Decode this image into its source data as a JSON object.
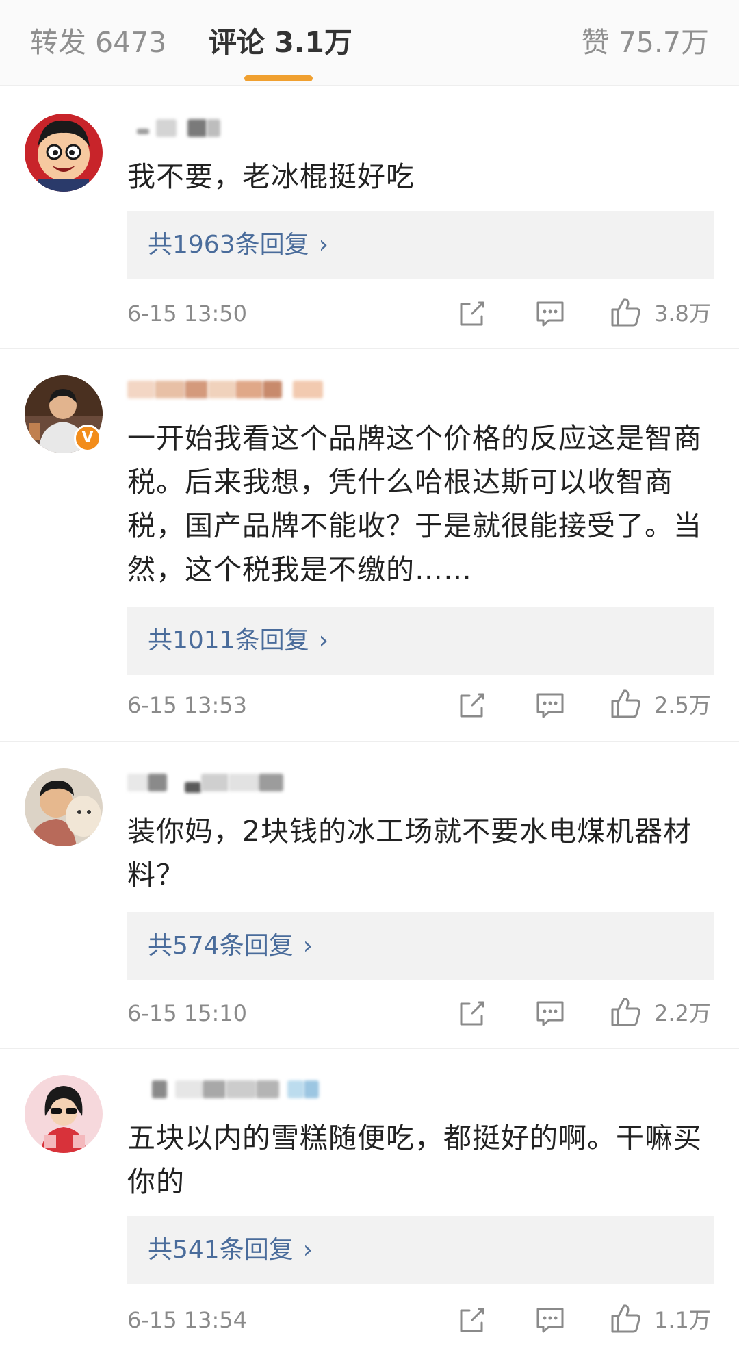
{
  "tabs": {
    "repost_label": "转发 6473",
    "comments_label": "评论 3.1万",
    "likes_label": "赞 75.7万"
  },
  "colors": {
    "accent": "#f0a030",
    "link": "#4a6c9b",
    "meta": "#8a8a8a",
    "reply_bg": "#f2f2f2",
    "verified_badge": "#f28c1a"
  },
  "comments": [
    {
      "content": "我不要，老冰棍挺好吃",
      "replies_label": "共1963条回复",
      "time": "6-15 13:50",
      "likes": "3.8万",
      "verified": false
    },
    {
      "content": "一开始我看这个品牌这个价格的反应这是智商税。后来我想，凭什么哈根达斯可以收智商税，国产品牌不能收？于是就很能接受了。当然，这个税我是不缴的……",
      "replies_label": "共1011条回复",
      "time": "6-15 13:53",
      "likes": "2.5万",
      "verified": true,
      "badge": "V"
    },
    {
      "content": "装你妈，2块钱的冰工场就不要水电煤机器材料？",
      "replies_label": "共574条回复",
      "time": "6-15 15:10",
      "likes": "2.2万",
      "verified": false
    },
    {
      "content": "五块以内的雪糕随便吃，都挺好的啊。干嘛买你的",
      "replies_label": "共541条回复",
      "time": "6-15 13:54",
      "likes": "1.1万",
      "verified": false
    }
  ],
  "icons": {
    "chevron": "chevron-right-icon",
    "share": "share-icon",
    "comment": "comment-icon",
    "like": "thumbs-up-icon"
  },
  "chevron_glyph": "›"
}
